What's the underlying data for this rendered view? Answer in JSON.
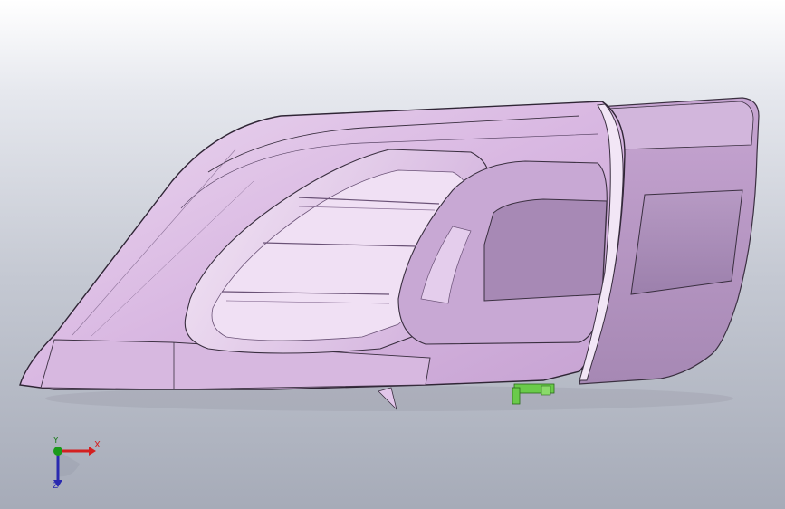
{
  "viewport": {
    "background_top": "#ffffff",
    "background_bottom": "#a6abb8",
    "model": {
      "name": "headlamp-assembly",
      "body_color": "#dcbde4",
      "shade_color": "#a78bb8",
      "edge_color": "#3a2f40",
      "connector_color": "#6acb4a"
    },
    "triad": {
      "x_label": "X",
      "y_label": "Y",
      "z_label": "Z",
      "x_color": "#d42020",
      "y_color": "#1a9a1a",
      "z_color": "#2a2ab0"
    }
  }
}
